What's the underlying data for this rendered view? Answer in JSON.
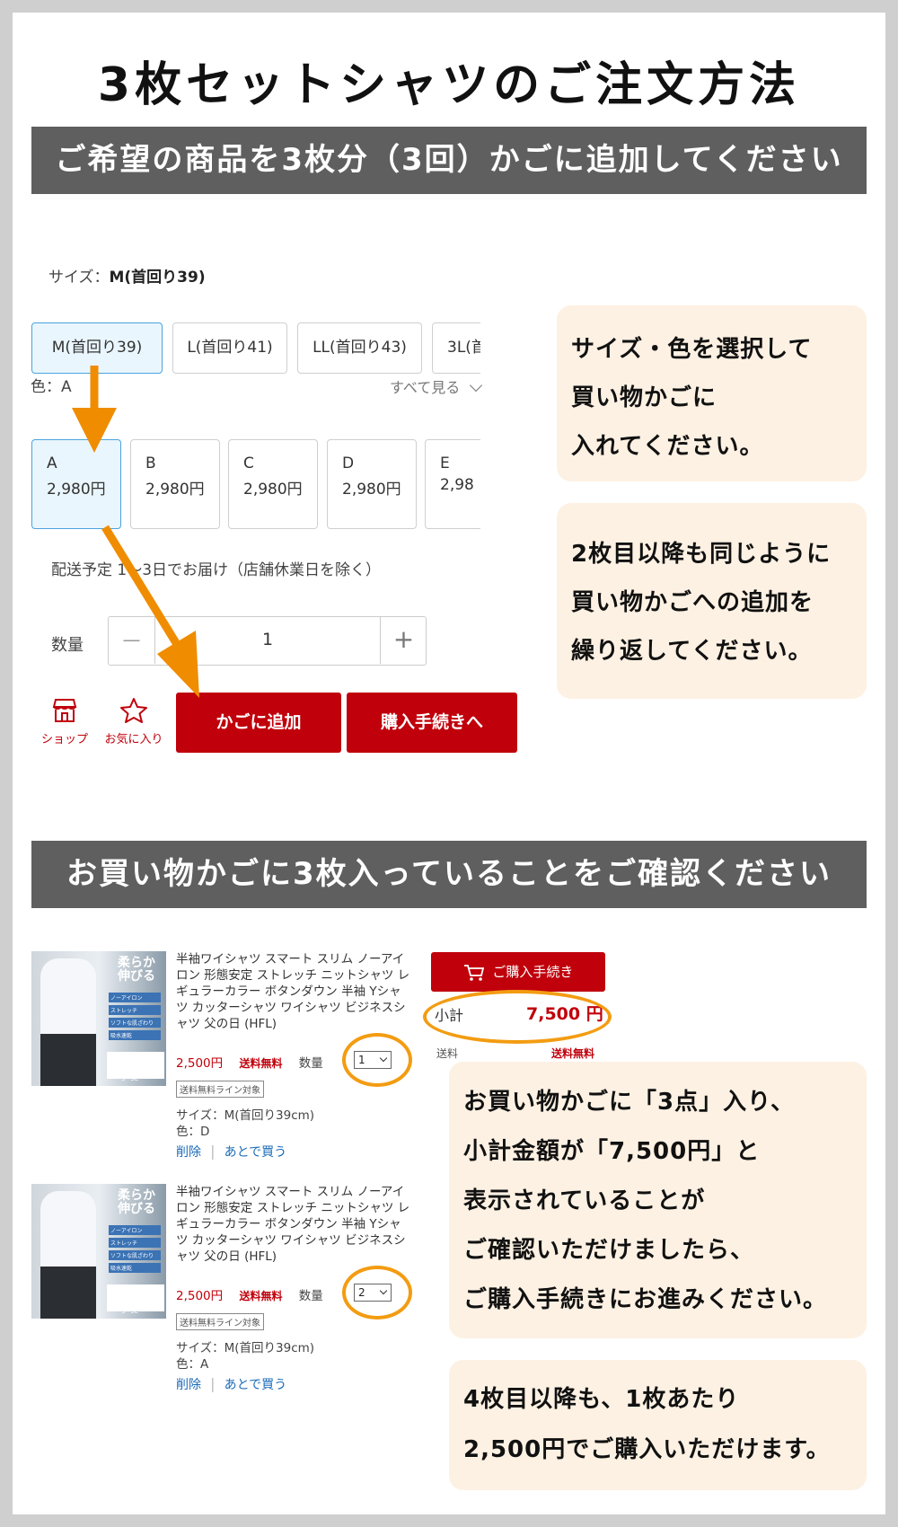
{
  "page": {
    "title": "3枚セットシャツのご注文方法",
    "banner1": "ご希望の商品を3枚分（3回）かごに追加してください",
    "banner2": "お買い物かごに3枚入っていることをご確認ください"
  },
  "colors": {
    "accent_red": "#c0000b",
    "banner_gray": "#5f5f5f",
    "note_bg": "#fdf1e3",
    "arrow_orange": "#f08c00",
    "selected_blue": "#4aa3df"
  },
  "product_panel": {
    "size_label": "サイズ：",
    "size_value": "M(首回り39)",
    "sizes": [
      "M(首回り39)",
      "L(首回り41)",
      "LL(首回り43)",
      "3L(首"
    ],
    "color_label": "色：A",
    "see_all": "すべて見る",
    "colors": [
      {
        "name": "A",
        "price": "2,980円"
      },
      {
        "name": "B",
        "price": "2,980円"
      },
      {
        "name": "C",
        "price": "2,980円"
      },
      {
        "name": "D",
        "price": "2,980円"
      },
      {
        "name": "E",
        "price": "2,98"
      }
    ],
    "delivery": "配送予定 1～3日でお届け（店舗休業日を除く）",
    "qty_label": "数量",
    "qty_minus": "—",
    "qty_value": "1",
    "qty_plus": "+",
    "shop_label": "ショップ",
    "fav_label": "お気に入り",
    "add_cart": "かごに追加",
    "checkout": "購入手続きへ"
  },
  "notes": {
    "note1": [
      "サイズ・色を選択して",
      "買い物かごに",
      "入れてください。"
    ],
    "note2": [
      "2枚目以降も同じように",
      "買い物かごへの追加を",
      "繰り返してください。"
    ],
    "note3": [
      "お買い物かごに「3点」入り、",
      "小計金額が「7,500円」と",
      "表示されていることが",
      "ご確認いただけましたら、",
      "ご購入手続きにお進みください。"
    ],
    "note4": [
      "4枚目以降も、1枚あたり",
      "2,500円でご購入いただけます。"
    ]
  },
  "cart": {
    "thumb_text": {
      "catch": "柔らか伸びる",
      "features": [
        "ノーアイロン",
        "ストレッチ",
        "ソフトな肌ざわり",
        "吸水速乾"
      ],
      "banner": "ボタンダウン半袖ワイシャツ",
      "range": "S~3L"
    },
    "items": [
      {
        "title": "半袖ワイシャツ スマート スリム ノーアイロン 形態安定 ストレッチ ニットシャツ レギュラーカラー ボタンダウン 半袖 Yシャツ カッターシャツ ワイシャツ ビジネスシャツ 父の日 (HFL)",
        "price": "2,500円",
        "shipping": "送料無料",
        "qty_label": "数量",
        "qty": "1",
        "tag": "送料無料ライン対象",
        "size": "サイズ：M(首回り39cm)",
        "color": "色：D",
        "delete": "削除",
        "later": "あとで買う"
      },
      {
        "title": "半袖ワイシャツ スマート スリム ノーアイロン 形態安定 ストレッチ ニットシャツ レギュラーカラー ボタンダウン 半袖 Yシャツ カッターシャツ ワイシャツ ビジネスシャツ 父の日 (HFL)",
        "price": "2,500円",
        "shipping": "送料無料",
        "qty_label": "数量",
        "qty": "2",
        "tag": "送料無料ライン対象",
        "size": "サイズ：M(首回り39cm)",
        "color": "色：A",
        "delete": "削除",
        "later": "あとで買う"
      }
    ],
    "checkout_button": "ご購入手続き",
    "subtotal_label": "小計",
    "subtotal_value": "7,500 円",
    "shipping_label": "送料",
    "shipping_value": "送料無料"
  }
}
